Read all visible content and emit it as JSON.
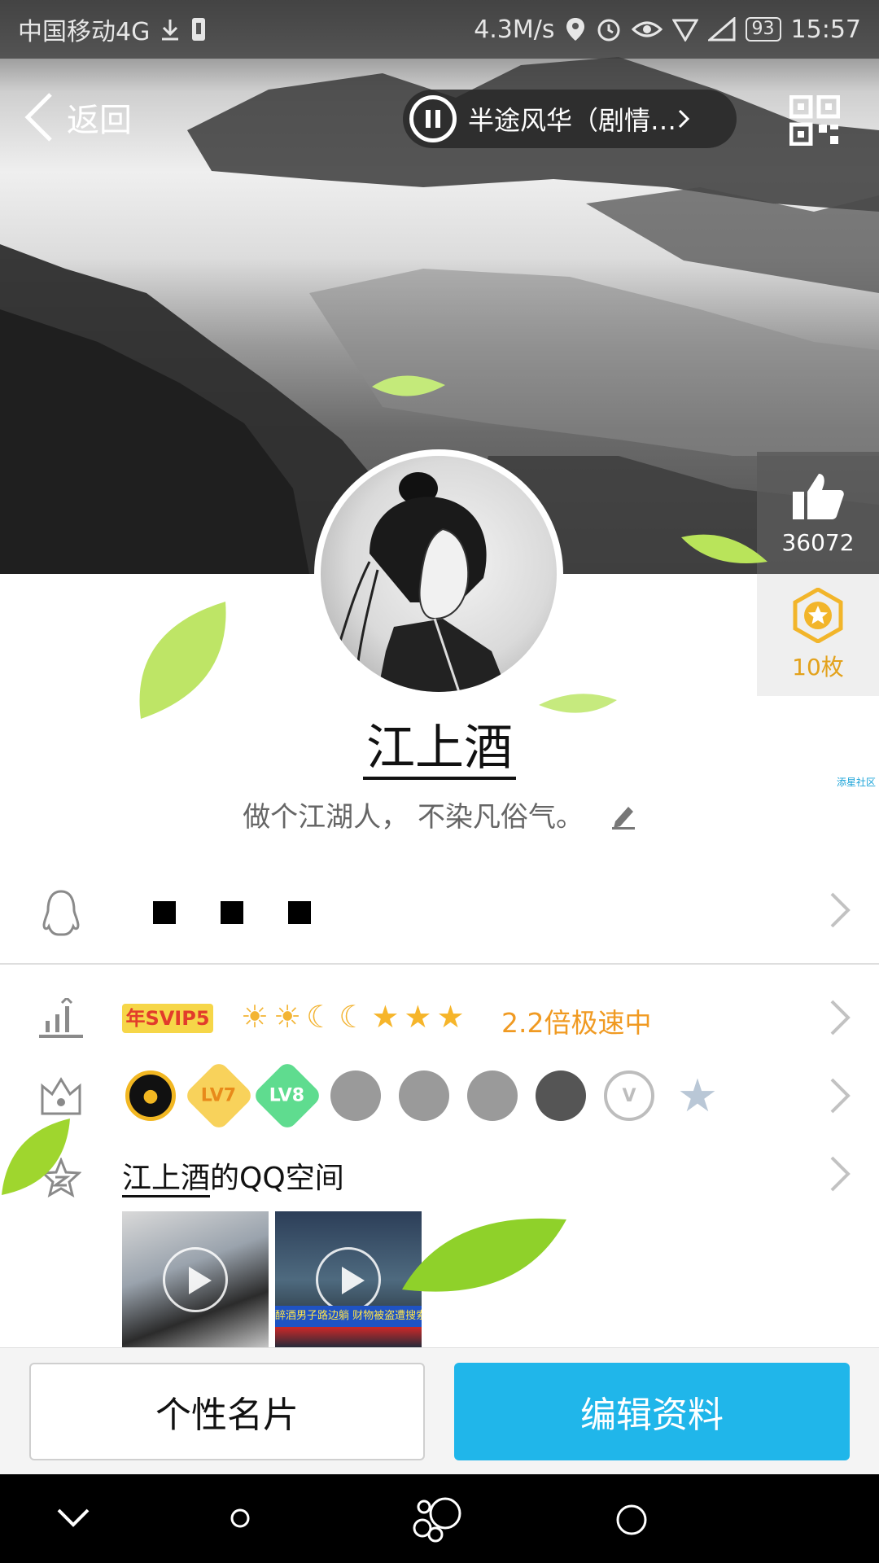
{
  "status_bar": {
    "carrier": "中国移动4G",
    "speed": "4.3M/s",
    "battery": "93",
    "time": "15:57"
  },
  "header": {
    "back_label": "返回",
    "music_title": "半途风华（剧情… "
  },
  "profile": {
    "likes_count": "36072",
    "stars_count": "10枚",
    "nickname": "江上酒",
    "signature": "做个江湖人， 不染凡俗气。",
    "watermark": "添星社区"
  },
  "rows": {
    "vip_badge": "年SVIP5",
    "level_icons": "☀☀☾☾★★★",
    "speed_text": "2.2倍极速中",
    "badges": [
      {
        "label": "",
        "color": "#f2b722",
        "icon": "qq-penguin-crown"
      },
      {
        "label": "LV7",
        "color": "#f3b433",
        "icon": "gold-diamond"
      },
      {
        "label": "LV8",
        "color": "#2fcf6b",
        "icon": "green-diamond"
      },
      {
        "label": "",
        "color": "#9a9a9a",
        "icon": "gray-penguin"
      },
      {
        "label": "",
        "color": "#9a9a9a",
        "icon": "gray-penguin"
      },
      {
        "label": "",
        "color": "#9a9a9a",
        "icon": "gray-penguin"
      },
      {
        "label": "",
        "color": "#555555",
        "icon": "dark-penguin-crown"
      },
      {
        "label": "V",
        "color": "#bdbdbd",
        "icon": "v-cloud"
      },
      {
        "label": "★",
        "color": "#b9c7d6",
        "icon": "star"
      }
    ],
    "qzone_owner": "江上酒",
    "qzone_suffix": "的QQ空间",
    "thumb2_caption": "醉酒男子路边躺 财物被盗遭搜索"
  },
  "buttons": {
    "card_label": "个性名片",
    "edit_label": "编辑资料"
  },
  "colors": {
    "accent": "#20b6ea",
    "vip_orange": "#f09a22",
    "star_gold": "#e3a21c"
  }
}
